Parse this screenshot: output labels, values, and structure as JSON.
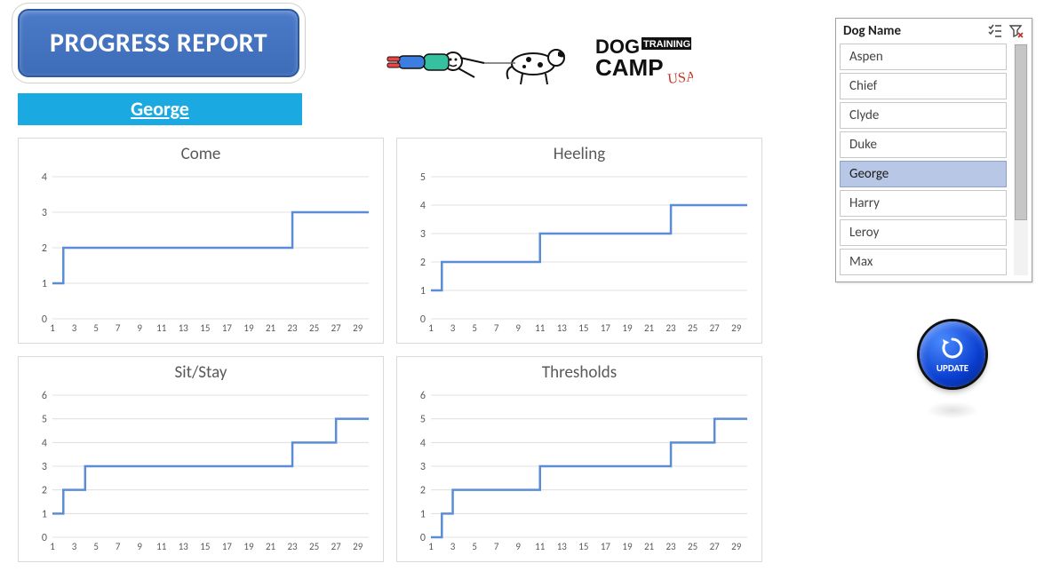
{
  "header": {
    "title": "PROGRESS REPORT",
    "logo_text_top": "DOG",
    "logo_text_mid": "TRAINING",
    "logo_text_bot": "CAMP",
    "logo_text_sub": "USA"
  },
  "selected_dog": "George",
  "slicer": {
    "title": "Dog Name",
    "items": [
      "Aspen",
      "Chief",
      "Clyde",
      "Duke",
      "George",
      "Harry",
      "Leroy",
      "Max"
    ],
    "selected": "George"
  },
  "buttons": {
    "update_label": "UPDATE"
  },
  "chart_data": [
    {
      "type": "line",
      "title": "Come",
      "x_ticks": [
        1,
        3,
        5,
        7,
        9,
        11,
        13,
        15,
        17,
        19,
        21,
        23,
        25,
        27,
        29
      ],
      "xlabel": "",
      "ylabel": "",
      "ylim": [
        0,
        4
      ],
      "y_ticks": [
        0,
        1,
        2,
        3,
        4
      ],
      "values": [
        1,
        2,
        2,
        2,
        2,
        2,
        2,
        2,
        2,
        2,
        2,
        2,
        2,
        2,
        2,
        2,
        2,
        2,
        2,
        2,
        2,
        2,
        3,
        3,
        3,
        3,
        3,
        3,
        3,
        3
      ]
    },
    {
      "type": "line",
      "title": "Heeling",
      "x_ticks": [
        1,
        3,
        5,
        7,
        9,
        11,
        13,
        15,
        17,
        19,
        21,
        23,
        25,
        27,
        29
      ],
      "xlabel": "",
      "ylabel": "",
      "ylim": [
        0,
        5
      ],
      "y_ticks": [
        0,
        1,
        2,
        3,
        4,
        5
      ],
      "values": [
        1,
        2,
        2,
        2,
        2,
        2,
        2,
        2,
        2,
        2,
        3,
        3,
        3,
        3,
        3,
        3,
        3,
        3,
        3,
        3,
        3,
        3,
        4,
        4,
        4,
        4,
        4,
        4,
        4,
        4
      ]
    },
    {
      "type": "line",
      "title": "Sit/Stay",
      "x_ticks": [
        1,
        3,
        5,
        7,
        9,
        11,
        13,
        15,
        17,
        19,
        21,
        23,
        25,
        27,
        29
      ],
      "xlabel": "",
      "ylabel": "",
      "ylim": [
        0,
        6
      ],
      "y_ticks": [
        0,
        1,
        2,
        3,
        4,
        5,
        6
      ],
      "values": [
        1,
        2,
        2,
        3,
        3,
        3,
        3,
        3,
        3,
        3,
        3,
        3,
        3,
        3,
        3,
        3,
        3,
        3,
        3,
        3,
        3,
        3,
        4,
        4,
        4,
        4,
        5,
        5,
        5,
        5
      ]
    },
    {
      "type": "line",
      "title": "Thresholds",
      "x_ticks": [
        1,
        3,
        5,
        7,
        9,
        11,
        13,
        15,
        17,
        19,
        21,
        23,
        25,
        27,
        29
      ],
      "xlabel": "",
      "ylabel": "",
      "ylim": [
        0,
        6
      ],
      "y_ticks": [
        0,
        1,
        2,
        3,
        4,
        5,
        6
      ],
      "values": [
        0,
        1,
        2,
        2,
        2,
        2,
        2,
        2,
        2,
        2,
        3,
        3,
        3,
        3,
        3,
        3,
        3,
        3,
        3,
        3,
        3,
        3,
        4,
        4,
        4,
        4,
        5,
        5,
        5,
        5
      ]
    }
  ]
}
